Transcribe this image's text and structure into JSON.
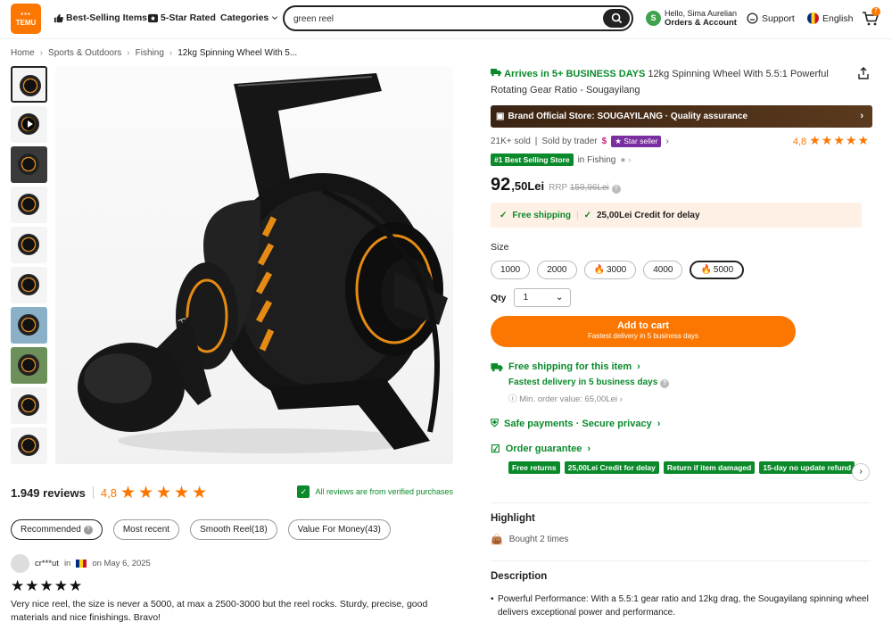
{
  "header": {
    "logo_text": "TEMU",
    "nav": [
      {
        "label": "Best-Selling Items",
        "icon": "thumbs-up-icon"
      },
      {
        "label": "5-Star Rated",
        "icon": "star-box-icon"
      },
      {
        "label": "Categories",
        "icon": "chevron-down-icon"
      }
    ],
    "search_value": "green reel",
    "account_greeting": "Hello, Sima Aurelian",
    "account_label": "Orders & Account",
    "avatar_letter": "S",
    "support_label": "Support",
    "language_label": "English",
    "cart_count": "7"
  },
  "breadcrumb": [
    "Home",
    "Sports & Outdoors",
    "Fishing",
    "12kg Spinning Wheel With 5..."
  ],
  "gallery": {
    "thumb_count": 10,
    "active_index": 0
  },
  "reviews": {
    "count_label": "1.949 reviews",
    "score": "4,8",
    "stars": "★★★★★",
    "verified_label": "All reviews are from verified purchases",
    "filters": [
      {
        "label": "Recommended",
        "selected": true
      },
      {
        "label": "Most recent"
      },
      {
        "label": "Smooth Reel(18)"
      },
      {
        "label": "Value For Money(43)"
      }
    ],
    "first_review": {
      "user": "cr***ut",
      "in_label": "in",
      "date": "on May 6, 2025",
      "stars": "★★★★★",
      "text": "Very nice reel, the size is never a 5000, at max a 2500-3000 but the reel rocks. Sturdy, precise, good materials and nice finishings. Bravo!"
    }
  },
  "product": {
    "arrives": "Arrives in 5+ BUSINESS DAYS",
    "title": "12kg Spinning Wheel With 5.5:1 Powerful Rotating Gear Ratio - Sougayilang",
    "brand_bar": "Brand Official Store: SOUGAYILANG · Quality assurance",
    "sold": "21K+ sold",
    "sold_by": "Sold by trader",
    "star_seller": "Star seller",
    "rating": "4,8",
    "rating_stars": "★★★★★",
    "best_badge": "#1 Best Selling Store",
    "best_category": "in Fishing",
    "price_main": "92",
    "price_cents": ",50Lei",
    "rrp_label": "RRP",
    "rrp_value": "159,96Lei",
    "free_shipping": "Free shipping",
    "credit": "25,00Lei Credit for delay",
    "size_label": "Size",
    "sizes": [
      {
        "label": "1000"
      },
      {
        "label": "2000"
      },
      {
        "label": "3000",
        "hot": true
      },
      {
        "label": "4000"
      },
      {
        "label": "5000",
        "hot": true,
        "selected": true
      }
    ],
    "qty_label": "Qty",
    "qty_value": "1",
    "cart_button": "Add to cart",
    "cart_sub": "Fastest delivery in 5 business days",
    "ship_item": "Free shipping for this item",
    "fast_delivery": "Fastest delivery in 5 business days",
    "min_order": "Min. order value: 65,00Lei",
    "safe": "Safe payments · Secure privacy",
    "guarantee": "Order guarantee",
    "guarantee_badges": [
      "Free returns",
      "25,00Lei Credit for delay",
      "Return if item damaged",
      "15-day no update refund"
    ],
    "highlight_title": "Highlight",
    "bought": "Bought 2 times",
    "description_title": "Description",
    "description_text": "Powerful Performance: With a 5.5:1 gear ratio and 12kg drag, the Sougayilang spinning wheel delivers exceptional power and performance."
  },
  "colors": {
    "accent": "#fb7701",
    "green": "#0a8a2a",
    "brand_bar": "#4a2f19"
  }
}
